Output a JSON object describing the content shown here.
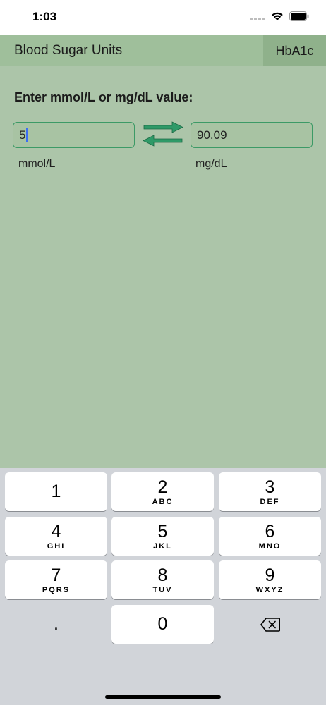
{
  "status_bar": {
    "time": "1:03"
  },
  "header": {
    "title": "Blood Sugar Units",
    "hba1c_button": "HbA1c"
  },
  "main": {
    "prompt": "Enter mmol/L or mg/dL value:",
    "mmol_value": "5",
    "mgdl_value": "90.09",
    "mmol_unit": "mmol/L",
    "mgdl_unit": "mg/dL"
  },
  "keyboard": {
    "keys": [
      {
        "digit": "1",
        "letters": ""
      },
      {
        "digit": "2",
        "letters": "ABC"
      },
      {
        "digit": "3",
        "letters": "DEF"
      },
      {
        "digit": "4",
        "letters": "GHI"
      },
      {
        "digit": "5",
        "letters": "JKL"
      },
      {
        "digit": "6",
        "letters": "MNO"
      },
      {
        "digit": "7",
        "letters": "PQRS"
      },
      {
        "digit": "8",
        "letters": "TUV"
      },
      {
        "digit": "9",
        "letters": "WXYZ"
      }
    ],
    "decimal_key": ".",
    "zero_key": "0",
    "delete_icon": "backspace-icon"
  },
  "colors": {
    "header_bg": "#9fbf9b",
    "content_bg": "#acc5a9",
    "accent_green": "#3c9a66",
    "keyboard_bg": "#d1d4d9"
  }
}
